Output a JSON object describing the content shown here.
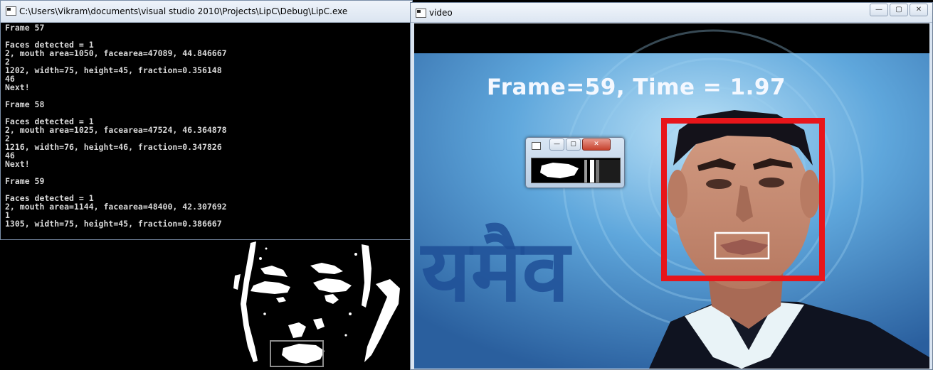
{
  "console": {
    "title": "C:\\Users\\Vikram\\documents\\visual studio 2010\\Projects\\LipC\\Debug\\LipC.exe",
    "lines": [
      "Frame 57",
      "",
      "Faces detected = 1",
      "2, mouth area=1050, facearea=47089, 44.846667",
      "2",
      "1202, width=75, height=45, fraction=0.356148",
      "46",
      "Next!",
      "",
      "Frame 58",
      "",
      "Faces detected = 1",
      "2, mouth area=1025, facearea=47524, 46.364878",
      "2",
      "1216, width=76, height=46, fraction=0.347826",
      "46",
      "Next!",
      "",
      "Frame 59",
      "",
      "Faces detected = 1",
      "2, mouth area=1144, facearea=48400, 42.307692",
      "1",
      "1305, width=75, height=45, fraction=0.386667"
    ]
  },
  "video": {
    "title": "video",
    "overlay_text": "Frame=59, Time = 1.97",
    "face_box_color": "#e8151a",
    "mouth_box_color": "#ffffff",
    "background_text": "यमैव"
  },
  "window_buttons": {
    "minimize": "—",
    "maximize": "▢",
    "close": "✕"
  },
  "colors": {
    "console_text": "#d8d8d8",
    "console_bg": "#000000",
    "studio_blue": "#2b6fb7"
  }
}
